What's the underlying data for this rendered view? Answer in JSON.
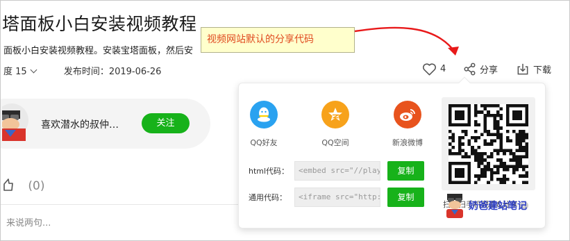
{
  "video": {
    "title": "塔面板小白安装视频教程",
    "description": "面板小白安装视频教程。安装宝塔面板，然后安",
    "plays": "度 15",
    "publish_time": "发布时间：2019-06-26"
  },
  "actions": {
    "like_count": "4",
    "share_label": "分享",
    "download_label": "下载"
  },
  "uploader": {
    "name": "喜欢潜水的叔仲…",
    "follow_label": "关注"
  },
  "likes": {
    "count": "(0)"
  },
  "comment": {
    "placeholder": "来说两句..."
  },
  "share_panel": {
    "networks": [
      {
        "label": "QQ好友",
        "icon": "qq-icon",
        "color": "#2aa2f0"
      },
      {
        "label": "QQ空间",
        "icon": "qzone-star-icon",
        "color": "#f7a21b"
      },
      {
        "label": "新浪微博",
        "icon": "weibo-icon",
        "color": "#e8531d"
      }
    ],
    "html_code_label": "html代码：",
    "html_code_value": "<embed src=\"//player.",
    "general_code_label": "通用代码：",
    "general_code_value": "<iframe src=\"http://op",
    "copy_label": "复制",
    "qr_caption": "扫一扫手机观看&分享"
  },
  "annotation": {
    "text": "视频网站默认的分享代码"
  },
  "watermark": {
    "text": "奶爸建站笔记"
  },
  "colors": {
    "accent_green": "#17b21a",
    "annotation_bg": "#ffffcc",
    "annotation_text": "#e04a1f",
    "arrow_red": "#e8191a",
    "watermark_blue": "#2e3fc6"
  }
}
